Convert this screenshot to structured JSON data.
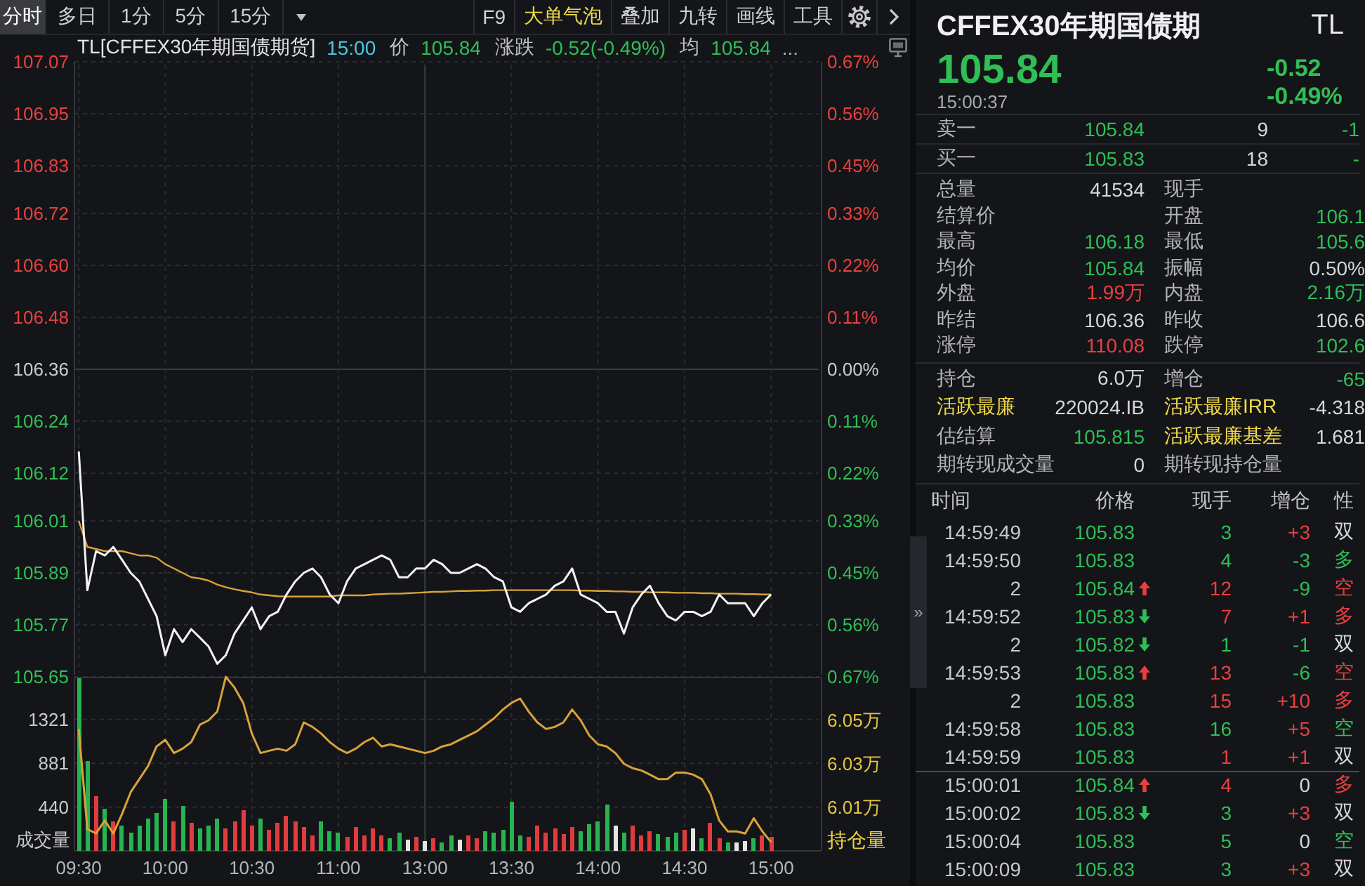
{
  "toolbar": {
    "tabs": [
      {
        "label": "分时",
        "selected": true
      },
      {
        "label": "多日",
        "selected": false
      },
      {
        "label": "1分",
        "selected": false
      },
      {
        "label": "5分",
        "selected": false
      },
      {
        "label": "15分",
        "selected": false
      }
    ],
    "tools": [
      {
        "label": "F9",
        "on": false
      },
      {
        "label": "大单气泡",
        "on": true
      },
      {
        "label": "叠加",
        "on": false
      },
      {
        "label": "九转",
        "on": false
      },
      {
        "label": "画线",
        "on": false
      },
      {
        "label": "工具",
        "on": false
      }
    ]
  },
  "info_bar": {
    "symbol": "TL[CFFEX30年期国债期货]",
    "time": "15:00",
    "fields": [
      {
        "label": "价",
        "value": "105.84",
        "color": "#2fbf56"
      },
      {
        "label": "涨跌",
        "value": "-0.52(-0.49%)",
        "color": "#2fbf56"
      },
      {
        "label": "均",
        "value": "105.84",
        "color": "#2fbf56"
      }
    ],
    "more": "..."
  },
  "price_pane": {
    "chart_data": {
      "type": "line",
      "grid": true,
      "categories": [
        null,
        null,
        null,
        null,
        null,
        null,
        null,
        null,
        null,
        null,
        null,
        null,
        null,
        null,
        null,
        null,
        null,
        null,
        null,
        null,
        null,
        null,
        null,
        null,
        null,
        null,
        null,
        null,
        null,
        null,
        null,
        null,
        null,
        null,
        null,
        null,
        null,
        null,
        null,
        null,
        null,
        null,
        null,
        null,
        null,
        null,
        null,
        null,
        null,
        null,
        null,
        null,
        null,
        null,
        null,
        null,
        null,
        null,
        null,
        null,
        null,
        null,
        null,
        null,
        null,
        null,
        null,
        null,
        null,
        null,
        null,
        null,
        null,
        null,
        null,
        null,
        null,
        null,
        null,
        null,
        null,
        null,
        null,
        null,
        null,
        null
      ],
      "ylim": [
        105.65,
        107.07
      ],
      "yticks": [
        {
          "value": 107.07,
          "label": "107.07"
        },
        {
          "value": 106.95,
          "label": "106.95"
        },
        {
          "value": 106.83,
          "label": "106.83"
        },
        {
          "value": 106.72,
          "label": "106.72"
        },
        {
          "value": 106.6,
          "label": "106.60"
        },
        {
          "value": 106.48,
          "label": "106.48"
        },
        {
          "value": 106.36,
          "label": "106.36"
        },
        {
          "value": 106.24,
          "label": "106.24"
        },
        {
          "value": 106.12,
          "label": "106.12"
        },
        {
          "value": 106.01,
          "label": "106.01"
        },
        {
          "value": 105.89,
          "label": "105.89"
        },
        {
          "value": 105.77,
          "label": "105.77"
        },
        {
          "value": 105.65,
          "label": "105.65"
        }
      ],
      "series": [
        {
          "color": "#f2f2f2",
          "values": [
            106.17,
            105.85,
            105.94,
            105.93,
            105.95,
            105.92,
            105.89,
            105.87,
            105.83,
            105.79,
            105.7,
            105.76,
            105.73,
            105.76,
            105.74,
            105.72,
            105.68,
            105.7,
            105.75,
            105.78,
            105.81,
            105.76,
            105.79,
            105.8,
            105.84,
            105.87,
            105.89,
            105.9,
            105.88,
            105.84,
            105.82,
            105.87,
            105.9,
            105.91,
            105.92,
            105.93,
            105.92,
            105.88,
            105.88,
            105.9,
            105.9,
            105.92,
            105.91,
            105.89,
            105.89,
            105.9,
            105.91,
            105.9,
            105.88,
            105.87,
            105.81,
            105.8,
            105.82,
            105.83,
            105.84,
            105.86,
            105.87,
            105.9,
            105.84,
            105.83,
            105.82,
            105.8,
            105.8,
            105.75,
            105.81,
            105.84,
            105.86,
            105.82,
            105.79,
            105.78,
            105.8,
            105.8,
            105.79,
            105.8,
            105.84,
            105.82,
            105.82,
            105.82,
            105.79,
            105.82,
            105.84,
            null,
            null,
            null,
            null,
            null
          ]
        },
        {
          "color": "#d9a23a",
          "values": [
            106.01,
            105.95,
            105.945,
            105.94,
            105.94,
            105.94,
            105.935,
            105.93,
            105.93,
            105.925,
            105.91,
            105.9,
            105.89,
            105.88,
            105.877,
            105.872,
            105.863,
            105.857,
            105.852,
            105.848,
            105.845,
            105.84,
            105.838,
            105.836,
            105.835,
            105.835,
            105.835,
            105.835,
            105.835,
            105.835,
            105.838,
            105.838,
            105.838,
            105.838,
            105.84,
            105.841,
            105.842,
            105.842,
            105.843,
            105.844,
            105.845,
            105.846,
            105.846,
            105.847,
            105.848,
            105.848,
            105.849,
            105.849,
            105.85,
            105.85,
            105.85,
            105.85,
            105.85,
            105.85,
            105.85,
            105.85,
            105.85,
            105.85,
            105.849,
            105.849,
            105.848,
            105.848,
            105.847,
            105.847,
            105.846,
            105.846,
            105.845,
            105.845,
            105.845,
            105.844,
            105.844,
            105.844,
            105.843,
            105.843,
            105.842,
            105.842,
            105.842,
            105.841,
            105.841,
            105.84,
            105.84,
            null,
            null,
            null,
            null,
            null
          ]
        }
      ]
    },
    "pct_axis": [
      {
        "label": "0.67%",
        "color": "#e8403f"
      },
      {
        "label": "0.56%",
        "color": "#e8403f"
      },
      {
        "label": "0.45%",
        "color": "#e8403f"
      },
      {
        "label": "0.33%",
        "color": "#e8403f"
      },
      {
        "label": "0.22%",
        "color": "#e8403f"
      },
      {
        "label": "0.11%",
        "color": "#e8403f"
      },
      {
        "label": "0.00%",
        "color": "#c9cacd"
      },
      {
        "label": "0.11%",
        "color": "#2fbf56"
      },
      {
        "label": "0.22%",
        "color": "#2fbf56"
      },
      {
        "label": "0.33%",
        "color": "#2fbf56"
      },
      {
        "label": "0.45%",
        "color": "#2fbf56"
      },
      {
        "label": "0.56%",
        "color": "#2fbf56"
      },
      {
        "label": "0.67%",
        "color": "#2fbf56"
      }
    ]
  },
  "volume_pane": {
    "chart_data": {
      "type": "bar",
      "grid": true,
      "ylabel": "成交量",
      "categories": [
        "09:30",
        null,
        null,
        null,
        null,
        null,
        null,
        null,
        null,
        null,
        "10:00",
        null,
        null,
        null,
        null,
        null,
        null,
        null,
        null,
        null,
        "10:30",
        null,
        null,
        null,
        null,
        null,
        null,
        null,
        null,
        null,
        "11:00",
        null,
        null,
        null,
        null,
        null,
        null,
        null,
        null,
        null,
        "13:00",
        null,
        null,
        null,
        null,
        null,
        null,
        null,
        null,
        null,
        "13:30",
        null,
        null,
        null,
        null,
        null,
        null,
        null,
        null,
        null,
        "14:00",
        null,
        null,
        null,
        null,
        null,
        null,
        null,
        null,
        null,
        "14:30",
        null,
        null,
        null,
        null,
        null,
        null,
        null,
        null,
        null,
        "15:00",
        null,
        null,
        null,
        null,
        null
      ],
      "ylim": [
        0,
        1750
      ],
      "yticks": [
        440,
        881,
        1321
      ],
      "series": [
        {
          "values": [
            1740,
            900,
            550,
            420,
            300,
            260,
            180,
            250,
            320,
            380,
            520,
            300,
            450,
            280,
            230,
            260,
            330,
            220,
            300,
            410,
            260,
            330,
            210,
            280,
            350,
            300,
            240,
            160,
            300,
            200,
            180,
            140,
            240,
            160,
            230,
            150,
            120,
            190,
            110,
            140,
            100,
            130,
            90,
            150,
            110,
            160,
            130,
            200,
            180,
            210,
            490,
            160,
            140,
            260,
            180,
            220,
            170,
            240,
            200,
            270,
            300,
            460,
            250,
            190,
            260,
            150,
            200,
            170,
            140,
            180,
            210,
            220,
            120,
            280,
            120,
            90,
            80,
            100,
            120,
            150,
            140,
            null,
            null,
            null,
            null,
            null
          ]
        }
      ]
    }
  },
  "open_interest_pane": {
    "chart_data": {
      "type": "line",
      "ylabel": "持仓量",
      "categories": [
        null,
        null,
        null,
        null,
        null,
        null,
        null,
        null,
        null,
        null,
        null,
        null,
        null,
        null,
        null,
        null,
        null,
        null,
        null,
        null,
        null,
        null,
        null,
        null,
        null,
        null,
        null,
        null,
        null,
        null,
        null,
        null,
        null,
        null,
        null,
        null,
        null,
        null,
        null,
        null,
        null,
        null,
        null,
        null,
        null,
        null,
        null,
        null,
        null,
        null,
        null,
        null,
        null,
        null,
        null,
        null,
        null,
        null,
        null,
        null,
        null,
        null,
        null,
        null,
        null,
        null,
        null,
        null,
        null,
        null,
        null,
        null,
        null,
        null,
        null,
        null,
        null,
        null,
        null,
        null,
        null,
        null,
        null,
        null,
        null,
        null
      ],
      "ylim": [
        5.99,
        6.07
      ],
      "yticks": [
        {
          "value": 6.01,
          "label": "6.01万"
        },
        {
          "value": 6.03,
          "label": "6.03万"
        },
        {
          "value": 6.05,
          "label": "6.05万"
        }
      ],
      "series": [
        {
          "color": "#d9a23a",
          "values": [
            6.046,
            6.0,
            5.998,
            6.004,
            5.998,
            6.007,
            6.017,
            6.023,
            6.029,
            6.038,
            6.041,
            6.035,
            6.037,
            6.04,
            6.048,
            6.05,
            6.054,
            6.07,
            6.065,
            6.058,
            6.044,
            6.035,
            6.036,
            6.037,
            6.036,
            6.039,
            6.049,
            6.047,
            6.044,
            6.04,
            6.037,
            6.035,
            6.037,
            6.04,
            6.042,
            6.038,
            6.039,
            6.038,
            6.037,
            6.036,
            6.035,
            6.036,
            6.038,
            6.039,
            6.041,
            6.043,
            6.045,
            6.048,
            6.051,
            6.055,
            6.058,
            6.06,
            6.054,
            6.049,
            6.046,
            6.047,
            6.049,
            6.055,
            6.05,
            6.043,
            6.039,
            6.038,
            6.035,
            6.03,
            6.028,
            6.027,
            6.025,
            6.023,
            6.023,
            6.026,
            6.026,
            6.025,
            6.023,
            6.016,
            6.004,
            5.999,
            5.999,
            5.998,
            6.005,
            5.999,
            5.994,
            null,
            null,
            null,
            null,
            null
          ]
        }
      ]
    }
  },
  "quote": {
    "name": "CFFEX30年期国债期",
    "code": "TL",
    "price": "105.84",
    "change": "-0.52",
    "change_pct": "-0.49%",
    "time": "15:00:37",
    "color": "#2fbf56"
  },
  "order_book": [
    {
      "label": "卖一",
      "price": {
        "text": "105.84",
        "color": "#2fbf56"
      },
      "qty": "9",
      "change": {
        "text": "-1",
        "color": "#2fbf56"
      }
    },
    {
      "label": "买一",
      "price": {
        "text": "105.83",
        "color": "#2fbf56"
      },
      "qty": "18",
      "change": {
        "text": "-",
        "color": "#2fbf56"
      }
    }
  ],
  "stats": [
    {
      "left": {
        "label": "总量",
        "value": "41534",
        "color": "#d6d7da"
      },
      "right": {
        "label": "现手"
      }
    },
    {
      "left": {
        "label": "结算价"
      },
      "right": {
        "label": "开盘",
        "value": "106.1",
        "color": "#2fbf56"
      }
    },
    {
      "left": {
        "label": "最高",
        "value": "106.18",
        "color": "#2fbf56"
      },
      "right": {
        "label": "最低",
        "value": "105.6",
        "color": "#2fbf56"
      }
    },
    {
      "left": {
        "label": "均价",
        "value": "105.84",
        "color": "#2fbf56"
      },
      "right": {
        "label": "振幅",
        "value": "0.50%",
        "color": "#d6d7da"
      }
    },
    {
      "left": {
        "label": "外盘",
        "value": "1.99万",
        "color": "#e8403f"
      },
      "right": {
        "label": "内盘",
        "value": "2.16万",
        "color": "#2fbf56"
      }
    },
    {
      "left": {
        "label": "昨结",
        "value": "106.36",
        "color": "#d6d7da"
      },
      "right": {
        "label": "昨收",
        "value": "106.6",
        "color": "#d6d7da"
      }
    },
    {
      "left": {
        "label": "涨停",
        "value": "110.08",
        "color": "#e8403f"
      },
      "right": {
        "label": "跌停",
        "value": "102.6",
        "color": "#2fbf56"
      }
    }
  ],
  "position_stats": [
    {
      "left": {
        "label": "持仓",
        "value": "6.0万",
        "color": "#d6d7da",
        "highlight": false
      },
      "right": {
        "label": "增仓",
        "value": "-65",
        "color": "#2fbf56",
        "highlight": false
      }
    },
    {
      "left": {
        "label": "活跃最廉",
        "value": "220024.IB",
        "color": "#d6d7da",
        "highlight": true
      },
      "right": {
        "label": "活跃最廉IRR",
        "value": "-4.318",
        "color": "#d6d7da",
        "highlight": true
      }
    },
    {
      "left": {
        "label": "估结算",
        "value": "105.815",
        "color": "#2fbf56",
        "highlight": false
      },
      "right": {
        "label": "活跃最廉基差",
        "value": "1.681",
        "color": "#d6d7da",
        "highlight": true
      }
    },
    {
      "left": {
        "label": "期转现成交量",
        "value": "0",
        "color": "#d6d7da",
        "highlight": false
      },
      "right": {
        "label": "期转现持仓量",
        "highlight": false
      }
    }
  ],
  "panel_toggle": "»",
  "trades": {
    "columns": [
      "时间",
      "价格",
      "现手",
      "增仓",
      "性"
    ],
    "rows": [
      {
        "kind": "plain",
        "time": "14:59:49",
        "price": {
          "text": "105.83",
          "color": "#2fbf56"
        },
        "volume": {
          "text": "3",
          "color": "#2fbf56"
        },
        "oi_change": {
          "text": "+3",
          "color": "#e8403f"
        },
        "nature": {
          "text": "双",
          "color": "#d6d7da"
        },
        "divider_above": false
      },
      {
        "kind": "plain",
        "time": "14:59:50",
        "price": {
          "text": "105.83",
          "color": "#2fbf56"
        },
        "volume": {
          "text": "4",
          "color": "#2fbf56"
        },
        "oi_change": {
          "text": "-3",
          "color": "#2fbf56"
        },
        "nature": {
          "text": "多",
          "color": "#2fbf56"
        },
        "divider_above": false
      },
      {
        "kind": "uptick",
        "time": "2",
        "price": {
          "text": "105.84",
          "color": "#2fbf56"
        },
        "volume": {
          "text": "12",
          "color": "#e8403f"
        },
        "oi_change": {
          "text": "-9",
          "color": "#2fbf56"
        },
        "nature": {
          "text": "空",
          "color": "#e8403f"
        },
        "divider_above": false
      },
      {
        "kind": "downtick",
        "time": "14:59:52",
        "price": {
          "text": "105.83",
          "color": "#2fbf56"
        },
        "volume": {
          "text": "7",
          "color": "#e8403f"
        },
        "oi_change": {
          "text": "+1",
          "color": "#e8403f"
        },
        "nature": {
          "text": "多",
          "color": "#e8403f"
        },
        "divider_above": false
      },
      {
        "kind": "downtick",
        "time": "2",
        "price": {
          "text": "105.82",
          "color": "#2fbf56"
        },
        "volume": {
          "text": "1",
          "color": "#2fbf56"
        },
        "oi_change": {
          "text": "-1",
          "color": "#2fbf56"
        },
        "nature": {
          "text": "双",
          "color": "#d6d7da"
        },
        "divider_above": false
      },
      {
        "kind": "uptick",
        "time": "14:59:53",
        "price": {
          "text": "105.83",
          "color": "#2fbf56"
        },
        "volume": {
          "text": "13",
          "color": "#e8403f"
        },
        "oi_change": {
          "text": "-6",
          "color": "#2fbf56"
        },
        "nature": {
          "text": "空",
          "color": "#e8403f"
        },
        "divider_above": false
      },
      {
        "kind": "plain",
        "time": "2",
        "price": {
          "text": "105.83",
          "color": "#2fbf56"
        },
        "volume": {
          "text": "15",
          "color": "#e8403f"
        },
        "oi_change": {
          "text": "+10",
          "color": "#e8403f"
        },
        "nature": {
          "text": "多",
          "color": "#e8403f"
        },
        "divider_above": false
      },
      {
        "kind": "plain",
        "time": "14:59:58",
        "price": {
          "text": "105.83",
          "color": "#2fbf56"
        },
        "volume": {
          "text": "16",
          "color": "#2fbf56"
        },
        "oi_change": {
          "text": "+5",
          "color": "#e8403f"
        },
        "nature": {
          "text": "空",
          "color": "#2fbf56"
        },
        "divider_above": false
      },
      {
        "kind": "plain",
        "time": "14:59:59",
        "price": {
          "text": "105.83",
          "color": "#2fbf56"
        },
        "volume": {
          "text": "1",
          "color": "#e8403f"
        },
        "oi_change": {
          "text": "+1",
          "color": "#e8403f"
        },
        "nature": {
          "text": "双",
          "color": "#d6d7da"
        },
        "divider_above": false
      },
      {
        "kind": "uptick",
        "time": "15:00:01",
        "price": {
          "text": "105.84",
          "color": "#2fbf56"
        },
        "volume": {
          "text": "4",
          "color": "#e8403f"
        },
        "oi_change": {
          "text": "0",
          "color": "#d6d7da"
        },
        "nature": {
          "text": "多",
          "color": "#e8403f"
        },
        "divider_above": true
      },
      {
        "kind": "downtick",
        "time": "15:00:02",
        "price": {
          "text": "105.83",
          "color": "#2fbf56"
        },
        "volume": {
          "text": "3",
          "color": "#2fbf56"
        },
        "oi_change": {
          "text": "+3",
          "color": "#e8403f"
        },
        "nature": {
          "text": "双",
          "color": "#d6d7da"
        },
        "divider_above": false
      },
      {
        "kind": "plain",
        "time": "15:00:04",
        "price": {
          "text": "105.83",
          "color": "#2fbf56"
        },
        "volume": {
          "text": "5",
          "color": "#2fbf56"
        },
        "oi_change": {
          "text": "0",
          "color": "#d6d7da"
        },
        "nature": {
          "text": "空",
          "color": "#2fbf56"
        },
        "divider_above": false
      },
      {
        "kind": "plain",
        "time": "15:00:09",
        "price": {
          "text": "105.83",
          "color": "#2fbf56"
        },
        "volume": {
          "text": "3",
          "color": "#2fbf56"
        },
        "oi_change": {
          "text": "+3",
          "color": "#e8403f"
        },
        "nature": {
          "text": "双",
          "color": "#d6d7da"
        },
        "divider_above": false
      }
    ]
  }
}
